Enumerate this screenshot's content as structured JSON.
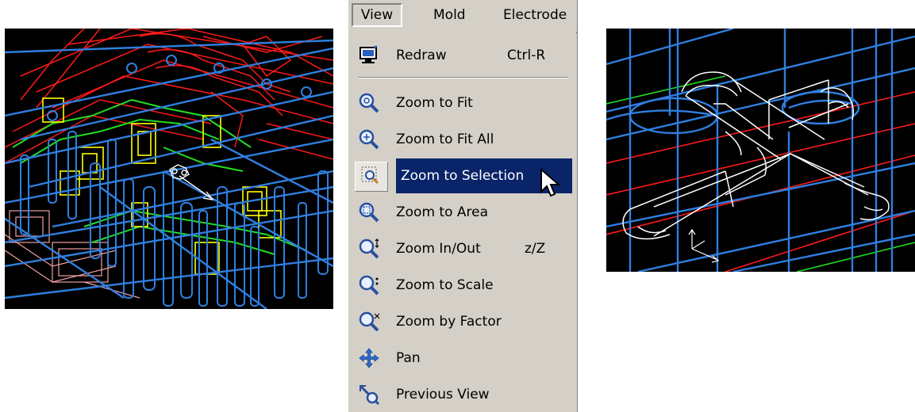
{
  "menubar": {
    "items": [
      {
        "label": "View",
        "active": true
      },
      {
        "label": "Mold",
        "active": false
      },
      {
        "label": "Electrode",
        "active": false
      }
    ]
  },
  "menu": {
    "items": [
      {
        "label": "Redraw",
        "shortcut": "Ctrl-R",
        "icon": "redraw-icon"
      },
      {
        "label": "Zoom to Fit",
        "shortcut": "",
        "icon": "zoom-fit-icon"
      },
      {
        "label": "Zoom to Fit All",
        "shortcut": "",
        "icon": "zoom-fit-all-icon"
      },
      {
        "label": "Zoom to Selection",
        "shortcut": "",
        "icon": "zoom-selection-icon",
        "highlighted": true
      },
      {
        "label": "Zoom to Area",
        "shortcut": "",
        "icon": "zoom-area-icon"
      },
      {
        "label": "Zoom In/Out",
        "shortcut": "z/Z",
        "icon": "zoom-in-out-icon"
      },
      {
        "label": "Zoom to Scale",
        "shortcut": "",
        "icon": "zoom-scale-icon"
      },
      {
        "label": "Zoom by Factor",
        "shortcut": "",
        "icon": "zoom-factor-icon"
      },
      {
        "label": "Pan",
        "shortcut": "",
        "icon": "pan-icon"
      },
      {
        "label": "Previous View",
        "shortcut": "",
        "icon": "previous-view-icon"
      }
    ]
  },
  "colors": {
    "menu_bg": "#d4d0c8",
    "highlight_bg": "#0a246a",
    "highlight_fg": "#ffffff",
    "viewport_bg": "#000000",
    "wire_blue": "#2f7fe0",
    "wire_red": "#ff1a1a",
    "wire_yellow": "#ffff00",
    "wire_green": "#22dd22",
    "wire_white": "#ffffff"
  }
}
